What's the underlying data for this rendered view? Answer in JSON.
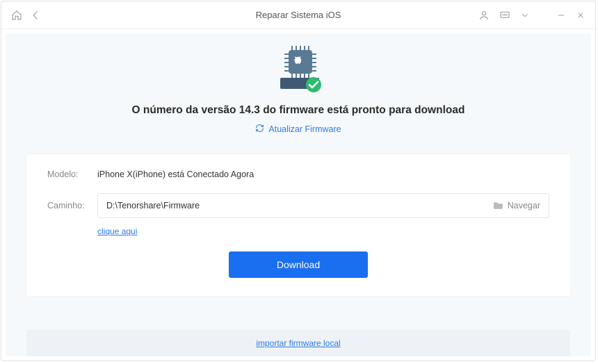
{
  "titlebar": {
    "title": "Reparar Sistema iOS"
  },
  "hero": {
    "headline": "O número da versão 14.3 do firmware está pronto para download",
    "refresh_label": "Atualizar Firmware"
  },
  "panel": {
    "model_label": "Modelo:",
    "model_value": "iPhone X(iPhone) está Conectado Agora",
    "path_label": "Caminho:",
    "path_value": "D:\\Tenorshare\\Firmware",
    "browse_label": "Navegar",
    "click_here": "clique aqui"
  },
  "actions": {
    "download_label": "Download"
  },
  "footer": {
    "import_local": "importar firmware local"
  }
}
